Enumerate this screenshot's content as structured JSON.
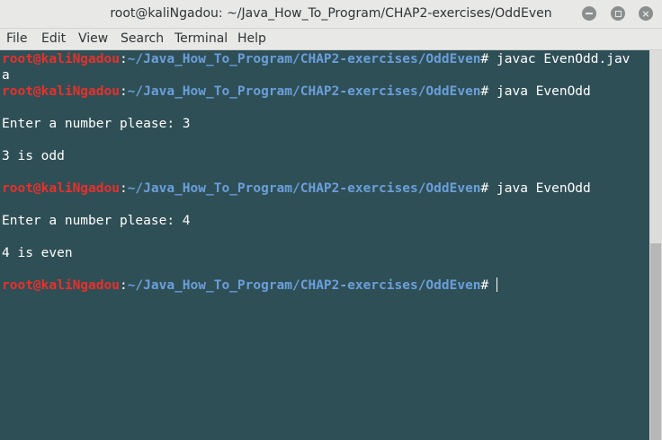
{
  "window": {
    "title": "root@kaliNgadou: ~/Java_How_To_Program/CHAP2-exercises/OddEven",
    "minimize_label": "–",
    "maximize_label": "□",
    "close_label": "×"
  },
  "menu": {
    "items": [
      "File",
      "Edit",
      "View",
      "Search",
      "Terminal",
      "Help"
    ]
  },
  "terminal": {
    "prompt_user": "root@kaliNgadou",
    "prompt_sep": ":",
    "prompt_path": "~/Java_How_To_Program/CHAP2-exercises/OddEven",
    "prompt_symbol": "# ",
    "cmd1": "javac EvenOdd.jav",
    "cmd1_wrap": "a",
    "cmd2": "java EvenOdd",
    "out1": "Enter a number please: 3",
    "out2": "3 is odd",
    "cmd3": "java EvenOdd",
    "out3": "Enter a number please: 4",
    "out4": "4 is even"
  },
  "colors": {
    "background": "#2f4f56",
    "prompt_user": "#e8302b",
    "prompt_path": "#6a9fda",
    "text": "#ffffff"
  }
}
